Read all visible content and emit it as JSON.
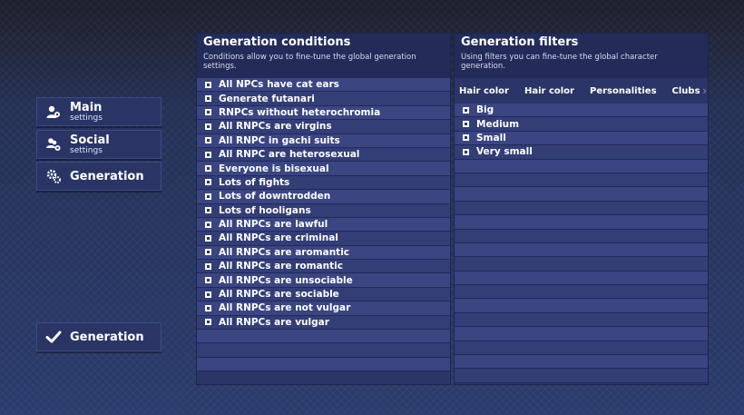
{
  "nav": {
    "main": {
      "label": "Main",
      "sub": "settings"
    },
    "social": {
      "label": "Social",
      "sub": "settings"
    },
    "generation": {
      "label": "Generation"
    },
    "bottom": {
      "label": "Generation"
    }
  },
  "conditions": {
    "title": "Generation conditions",
    "desc": "Conditions allow you to fine-tune the global generation settings.",
    "items": [
      "All NPCs have cat ears",
      "Generate futanari",
      "RNPCs without heterochromia",
      "All RNPCs are virgins",
      "All RNPC in gachi suits",
      "All RNPC are heterosexual",
      "Everyone is bisexual",
      "Lots of fights",
      "Lots of downtrodden",
      "Lots of hooligans",
      "All RNPCs are lawful",
      "All RNPCs are criminal",
      "All RNPCs are aromantic",
      "All RNPCs are romantic",
      "All RNPCs are unsociable",
      "All RNPCs are sociable",
      "All RNPCs are not vulgar",
      "All RNPCs are vulgar"
    ]
  },
  "filters": {
    "title": "Generation filters",
    "desc": "Using filters you can fine-tune the global character generation.",
    "tabs": [
      "Hair color",
      "Hair color",
      "Personalities",
      "Clubs"
    ],
    "items": [
      "Big",
      "Medium",
      "Small",
      "Very small"
    ]
  }
}
